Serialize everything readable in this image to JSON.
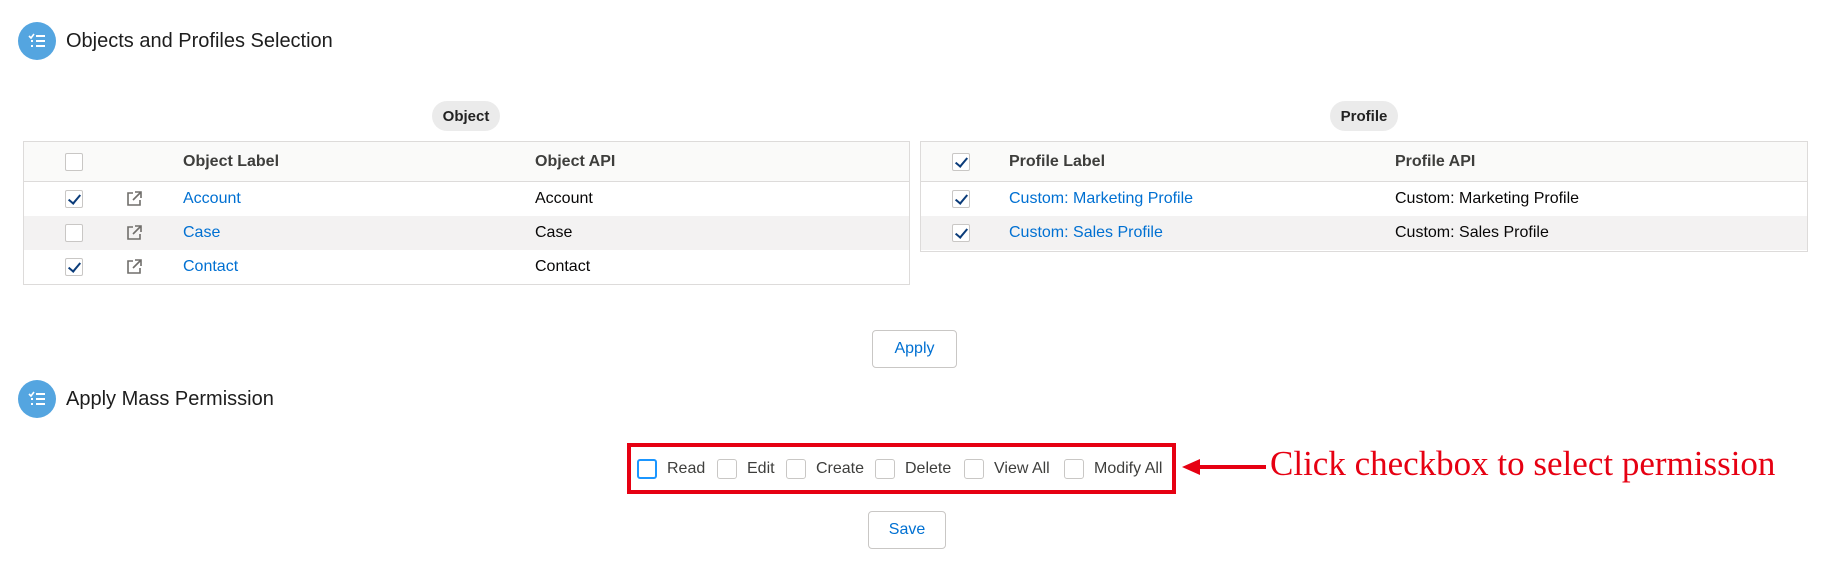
{
  "sections": {
    "objects_profiles": {
      "title": "Objects and Profiles Selection",
      "icon": "task-list-icon"
    },
    "mass_permission": {
      "title": "Apply Mass Permission",
      "icon": "task-list-icon"
    }
  },
  "object_table": {
    "pill": "Object",
    "headers": {
      "label": "Object Label",
      "api": "Object API"
    },
    "select_all_checked": false,
    "rows": [
      {
        "label": "Account",
        "api": "Account",
        "checked": true,
        "icon": "external-link-icon"
      },
      {
        "label": "Case",
        "api": "Case",
        "checked": false,
        "icon": "external-link-icon"
      },
      {
        "label": "Contact",
        "api": "Contact",
        "checked": true,
        "icon": "external-link-icon"
      }
    ]
  },
  "profile_table": {
    "pill": "Profile",
    "headers": {
      "label": "Profile Label",
      "api": "Profile API"
    },
    "select_all_checked": true,
    "rows": [
      {
        "label": "Custom: Marketing Profile",
        "api": "Custom: Marketing Profile",
        "checked": true
      },
      {
        "label": "Custom: Sales Profile",
        "api": "Custom: Sales Profile",
        "checked": true
      }
    ]
  },
  "buttons": {
    "apply": "Apply",
    "save": "Save"
  },
  "permissions": [
    {
      "label": "Read",
      "checked": false,
      "focused": true
    },
    {
      "label": "Edit",
      "checked": false
    },
    {
      "label": "Create",
      "checked": false
    },
    {
      "label": "Delete",
      "checked": false
    },
    {
      "label": "View All",
      "checked": false
    },
    {
      "label": "Modify All",
      "checked": false
    }
  ],
  "annotation": {
    "text": "Click checkbox to select permission",
    "color": "#e60012"
  },
  "colors": {
    "link": "#0070d2",
    "icon_bg": "#54a5e0",
    "highlight": "#e60012"
  }
}
